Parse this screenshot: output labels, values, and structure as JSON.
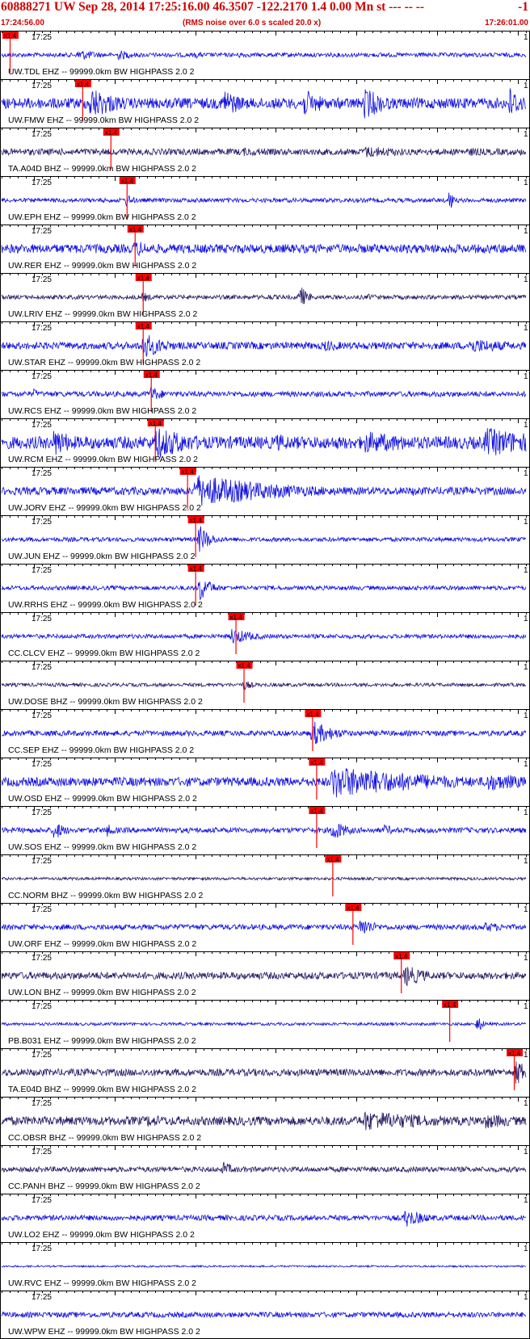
{
  "header": {
    "title": "60888271 UW Sep 28, 2014 17:25:16.00   46.3507 -122.2170  1.4 0.00 Mn st --- -- --",
    "title_end": "-1",
    "start_time": "17:24:56.00",
    "note": "(RMS noise over 6.0 s scaled 20.0 x)",
    "end_time": "17:26:01.00"
  },
  "chart_data": {
    "type": "line",
    "title": "60888271 UW Sep 28, 2014 17:25:16.00   46.3507 -122.2170  1.4 0.00 Mn st --- -- --",
    "x_start": "17:24:56.00",
    "x_end": "17:26:01.00",
    "x_range_seconds": [
      0,
      65
    ],
    "time_mark_label": "17:25",
    "time_mark_seconds": 4,
    "pick_label": "x1.4",
    "edge_label": "1",
    "grid": false,
    "colors": {
      "blue": "#1010e0",
      "dark": "#2a1a66",
      "pick": "#ff0000",
      "axis": "#000000",
      "header": "#d00000"
    },
    "traces": [
      {
        "label": "UW.TDL EHZ -- 99999.0km BW  HIGHPASS  2.0  2",
        "pick_seconds": 1.0,
        "color": "blue",
        "noise": 0.12,
        "events": [
          {
            "t": 9.5,
            "amp": 0.35,
            "dur": 3.0
          },
          {
            "t": 14.5,
            "amp": 0.3,
            "dur": 2.5
          },
          {
            "t": 24.0,
            "amp": 0.2,
            "dur": 2.0
          },
          {
            "t": 29.5,
            "amp": 0.2,
            "dur": 2.0
          },
          {
            "t": 47.0,
            "amp": 0.15,
            "dur": 2.5
          }
        ]
      },
      {
        "label": "UW.FMW EHZ -- 99999.0km BW  HIGHPASS  2.0  2",
        "pick_seconds": 10.0,
        "color": "blue",
        "noise": 0.3,
        "events": [
          {
            "t": 11.0,
            "amp": 0.95,
            "dur": 4.0
          },
          {
            "t": 27.5,
            "amp": 0.9,
            "dur": 2.5
          },
          {
            "t": 37.5,
            "amp": 0.8,
            "dur": 3.0
          },
          {
            "t": 45.0,
            "amp": 0.95,
            "dur": 3.0
          },
          {
            "t": 63.0,
            "amp": 0.95,
            "dur": 2.0
          }
        ]
      },
      {
        "label": "TA.A04D BHZ -- 99999.0km BW  HIGHPASS  2.0  2",
        "pick_seconds": 13.5,
        "color": "dark",
        "noise": 0.18,
        "events": [
          {
            "t": 30.0,
            "amp": 0.25,
            "dur": 10.0
          },
          {
            "t": 45.0,
            "amp": 0.35,
            "dur": 8.0
          },
          {
            "t": 58.0,
            "amp": 0.25,
            "dur": 6.0
          }
        ]
      },
      {
        "label": "UW.EPH EHZ -- 99999.0km BW  HIGHPASS  2.0  2",
        "pick_seconds": 15.5,
        "color": "blue",
        "noise": 0.12,
        "events": [
          {
            "t": 15.5,
            "amp": 0.4,
            "dur": 1.0
          },
          {
            "t": 55.5,
            "amp": 0.85,
            "dur": 0.4
          }
        ]
      },
      {
        "label": "UW.RER EHZ -- 99999.0km BW  HIGHPASS  2.0  2",
        "pick_seconds": 16.5,
        "color": "blue",
        "noise": 0.25,
        "events": [
          {
            "t": 16.5,
            "amp": 0.5,
            "dur": 3.0
          },
          {
            "t": 62.0,
            "amp": 0.3,
            "dur": 3.0
          }
        ]
      },
      {
        "label": "UW.LRIV EHZ -- 99999.0km BW  HIGHPASS  2.0  2",
        "pick_seconds": 17.5,
        "color": "dark",
        "noise": 0.12,
        "events": [
          {
            "t": 17.5,
            "amp": 0.3,
            "dur": 1.5
          },
          {
            "t": 33.0,
            "amp": 0.2,
            "dur": 2.0
          },
          {
            "t": 37.0,
            "amp": 0.7,
            "dur": 1.0
          },
          {
            "t": 45.5,
            "amp": 0.2,
            "dur": 2.0
          }
        ]
      },
      {
        "label": "UW.STAR EHZ -- 99999.0km BW  HIGHPASS  2.0  2",
        "pick_seconds": 17.5,
        "color": "blue",
        "noise": 0.2,
        "events": [
          {
            "t": 17.5,
            "amp": 0.8,
            "dur": 3.0
          },
          {
            "t": 40.0,
            "amp": 0.35,
            "dur": 4.0
          },
          {
            "t": 58.0,
            "amp": 0.45,
            "dur": 7.0
          }
        ]
      },
      {
        "label": "UW.RCS EHZ -- 99999.0km BW  HIGHPASS  2.0  2",
        "pick_seconds": 18.5,
        "color": "blue",
        "noise": 0.15,
        "events": [
          {
            "t": 4.0,
            "amp": 0.3,
            "dur": 1.0
          },
          {
            "t": 18.5,
            "amp": 0.45,
            "dur": 2.0
          }
        ]
      },
      {
        "label": "UW.RCM EHZ -- 99999.0km BW  HIGHPASS  2.0  2",
        "pick_seconds": 19.0,
        "color": "blue",
        "noise": 0.35,
        "events": [
          {
            "t": 6.5,
            "amp": 0.85,
            "dur": 3.0
          },
          {
            "t": 19.0,
            "amp": 0.95,
            "dur": 6.0
          },
          {
            "t": 34.0,
            "amp": 0.5,
            "dur": 6.0
          },
          {
            "t": 45.0,
            "amp": 0.65,
            "dur": 10.0
          },
          {
            "t": 60.0,
            "amp": 0.85,
            "dur": 10.0
          }
        ]
      },
      {
        "label": "UW.JORV EHZ -- 99999.0km BW  HIGHPASS  2.0  2",
        "pick_seconds": 23.0,
        "color": "blue",
        "noise": 0.22,
        "events": [
          {
            "t": 24.0,
            "amp": 0.95,
            "dur": 12.0
          },
          {
            "t": 51.0,
            "amp": 0.3,
            "dur": 3.0
          }
        ]
      },
      {
        "label": "UW.JUN EHZ -- 99999.0km BW  HIGHPASS  2.0  2",
        "pick_seconds": 24.0,
        "color": "blue",
        "noise": 0.12,
        "events": [
          {
            "t": 24.5,
            "amp": 0.85,
            "dur": 1.5
          }
        ]
      },
      {
        "label": "UW.RRHS EHZ -- 99999.0km BW  HIGHPASS  2.0  2",
        "pick_seconds": 24.0,
        "color": "blue",
        "noise": 0.12,
        "events": [
          {
            "t": 24.5,
            "amp": 0.85,
            "dur": 1.5
          }
        ]
      },
      {
        "label": "CC.CLCV EHZ -- 99999.0km BW  HIGHPASS  2.0  2",
        "pick_seconds": 29.0,
        "color": "blue",
        "noise": 0.12,
        "events": [
          {
            "t": 28.5,
            "amp": 0.5,
            "dur": 3.0
          }
        ]
      },
      {
        "label": "UW.DOSE BHZ -- 99999.0km BW  HIGHPASS  2.0  2",
        "pick_seconds": 30.0,
        "color": "dark",
        "noise": 0.1,
        "events": [
          {
            "t": 30.0,
            "amp": 0.3,
            "dur": 1.5
          }
        ]
      },
      {
        "label": "CC.SEP EHZ -- 99999.0km BW  HIGHPASS  2.0  2",
        "pick_seconds": 38.5,
        "color": "blue",
        "noise": 0.15,
        "events": [
          {
            "t": 38.5,
            "amp": 0.75,
            "dur": 3.0
          }
        ]
      },
      {
        "label": "UW.OSD EHZ -- 99999.0km BW  HIGHPASS  2.0  2",
        "pick_seconds": 39.0,
        "color": "blue",
        "noise": 0.25,
        "events": [
          {
            "t": 41.0,
            "amp": 0.95,
            "dur": 14.0
          },
          {
            "t": 60.0,
            "amp": 0.55,
            "dur": 8.0
          }
        ]
      },
      {
        "label": "UW.SOS EHZ -- 99999.0km BW  HIGHPASS  2.0  2",
        "pick_seconds": 39.0,
        "color": "blue",
        "noise": 0.15,
        "events": [
          {
            "t": 6.5,
            "amp": 0.6,
            "dur": 1.5
          },
          {
            "t": 13.0,
            "amp": 0.4,
            "dur": 1.5
          },
          {
            "t": 41.0,
            "amp": 0.65,
            "dur": 2.0
          },
          {
            "t": 47.5,
            "amp": 0.35,
            "dur": 1.5
          }
        ]
      },
      {
        "label": "CC.NORM BHZ -- 99999.0km BW  HIGHPASS  2.0  2",
        "pick_seconds": 41.0,
        "color": "dark",
        "noise": 0.08,
        "events": []
      },
      {
        "label": "UW.ORF EHZ -- 99999.0km BW  HIGHPASS  2.0  2",
        "pick_seconds": 43.5,
        "color": "blue",
        "noise": 0.15,
        "events": [
          {
            "t": 44.5,
            "amp": 0.6,
            "dur": 2.0
          },
          {
            "t": 60.0,
            "amp": 0.3,
            "dur": 4.0
          }
        ]
      },
      {
        "label": "UW.LON BHZ -- 99999.0km BW  HIGHPASS  2.0  2",
        "pick_seconds": 49.5,
        "color": "dark",
        "noise": 0.2,
        "events": [
          {
            "t": 50.0,
            "amp": 0.65,
            "dur": 3.0
          },
          {
            "t": 20.0,
            "amp": 0.25,
            "dur": 2.0
          }
        ]
      },
      {
        "label": "PB.B031 EHZ -- 99999.0km BW  HIGHPASS  2.0  2",
        "pick_seconds": 55.5,
        "color": "blue",
        "noise": 0.08,
        "events": [
          {
            "t": 59.0,
            "amp": 0.55,
            "dur": 0.7
          }
        ]
      },
      {
        "label": "TA.E04D BHZ -- 99999.0km BW  HIGHPASS  2.0  2",
        "pick_seconds": 63.5,
        "color": "dark",
        "noise": 0.2,
        "events": [
          {
            "t": 63.8,
            "amp": 0.85,
            "dur": 1.5
          }
        ]
      },
      {
        "label": "CC.OBSR BHZ -- 99999.0km BW  HIGHPASS  2.0  2",
        "pick_seconds": null,
        "color": "dark",
        "noise": 0.25,
        "events": [
          {
            "t": 18.0,
            "amp": 0.35,
            "dur": 8.0
          },
          {
            "t": 45.0,
            "amp": 0.6,
            "dur": 12.0
          },
          {
            "t": 60.0,
            "amp": 0.45,
            "dur": 6.0
          }
        ]
      },
      {
        "label": "CC.PANH BHZ -- 99999.0km BW  HIGHPASS  2.0  2",
        "pick_seconds": null,
        "color": "dark",
        "noise": 0.15,
        "events": [
          {
            "t": 27.5,
            "amp": 0.45,
            "dur": 1.5
          }
        ]
      },
      {
        "label": "UW.LO2 EHZ -- 99999.0km BW  HIGHPASS  2.0  2",
        "pick_seconds": null,
        "color": "blue",
        "noise": 0.15,
        "events": [
          {
            "t": 50.0,
            "amp": 0.55,
            "dur": 3.0
          }
        ]
      },
      {
        "label": "UW.RVC EHZ -- 99999.0km BW  HIGHPASS  2.0  2",
        "pick_seconds": null,
        "color": "blue",
        "noise": 0.05,
        "events": []
      },
      {
        "label": "UW.WPW EHZ -- 99999.0km BW  HIGHPASS  2.0  2",
        "pick_seconds": null,
        "color": "blue",
        "noise": 0.15,
        "events": []
      }
    ]
  }
}
